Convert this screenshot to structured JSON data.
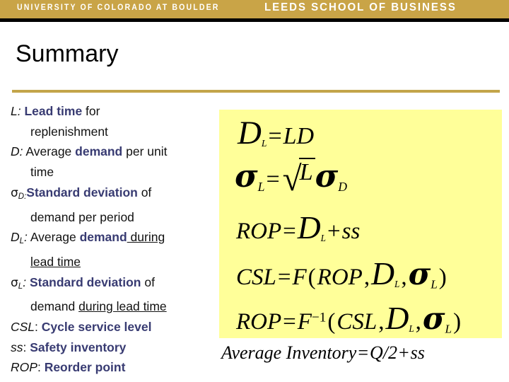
{
  "banner": {
    "left_text": "UNIVERSITY OF COLORADO AT BOULDER",
    "right_text": "LEEDS SCHOOL OF BUSINESS",
    "background_color": "#c9a447",
    "text_color": "#ffffff"
  },
  "slide": {
    "title": "Summary",
    "rule_color": "#c3a54a",
    "keyword_color": "#383b72",
    "panel_color": "#ffff99"
  },
  "definitions": [
    {
      "symbol": "L",
      "symbol_suffix": ":",
      "line1_bold": "Lead time",
      "line1_rest": " for",
      "line2": "replenishment"
    },
    {
      "symbol": "D",
      "symbol_suffix": ":",
      "line1_pre": "Average ",
      "line1_bold": "demand",
      "line1_rest": " per unit",
      "line2": "time"
    },
    {
      "symbol": "σ",
      "subscript": "D",
      "symbol_suffix": ":",
      "line1_bold": "Standard deviation",
      "line1_rest": " of",
      "line2": "demand per period"
    },
    {
      "symbol": "D",
      "subscript": "L",
      "symbol_suffix": ":",
      "line1_pre": "Average ",
      "line1_bold": "demand",
      "line1_underline": " during",
      "line2_underline": "lead time"
    },
    {
      "symbol": "σ",
      "subscript": "L",
      "symbol_suffix": ":",
      "line1_bold": "Standard deviation",
      "line1_rest": " of",
      "line2_pre": "demand ",
      "line2_underline": "during lead time"
    },
    {
      "symbol": "CSL",
      "symbol_suffix": ":",
      "line1_bold": "Cycle service level"
    },
    {
      "symbol": "ss",
      "symbol_suffix": ":",
      "line1_bold": "Safety inventory"
    },
    {
      "symbol": "ROP",
      "symbol_suffix": ":",
      "line1_bold": "Reorder point"
    }
  ],
  "formulas": {
    "f1": "D_L = LD",
    "f2": "σ_L = √L σ_D",
    "f3": "ROP = D_L + ss",
    "f4": "CSL = F(ROP, D_L, σ_L)",
    "f5": "ROP = F^-1(CSL, D_L, σ_L)",
    "average_inventory": "Average Inventory = Q/2 + ss"
  },
  "formula_parts": {
    "f1": {
      "lhs_var": "D",
      "lhs_sub": "L",
      "eq": "=",
      "rhs": "LD"
    },
    "f2": {
      "lhs_var": "σ",
      "lhs_sub": "L",
      "eq": "=",
      "radicand": "L",
      "factor_var": "σ",
      "factor_sub": "D"
    },
    "f3": {
      "lhs": "ROP",
      "eq": "=",
      "rhs_var": "D",
      "rhs_sub": "L",
      "plus": "+",
      "tail": "ss"
    },
    "f4": {
      "lhs": "CSL",
      "eq": "=",
      "fn": "F",
      "open": "(",
      "a": "ROP",
      "c1": ",",
      "b_var": "D",
      "b_sub": "L",
      "c2": ",",
      "c_var": "σ",
      "c_sub": "L",
      "close": ")"
    },
    "f5": {
      "lhs": "ROP",
      "eq": "=",
      "fn": "F",
      "exp": "−1",
      "open": "(",
      "a": "CSL",
      "c1": ",",
      "b_var": "D",
      "b_sub": "L",
      "c2": ",",
      "c_var": "σ",
      "c_sub": "L",
      "close": ")"
    },
    "avg": {
      "label": "Average Inventory",
      "eq": "=",
      "rhs": "Q/2",
      "plus": "+",
      "tail": "ss"
    }
  }
}
